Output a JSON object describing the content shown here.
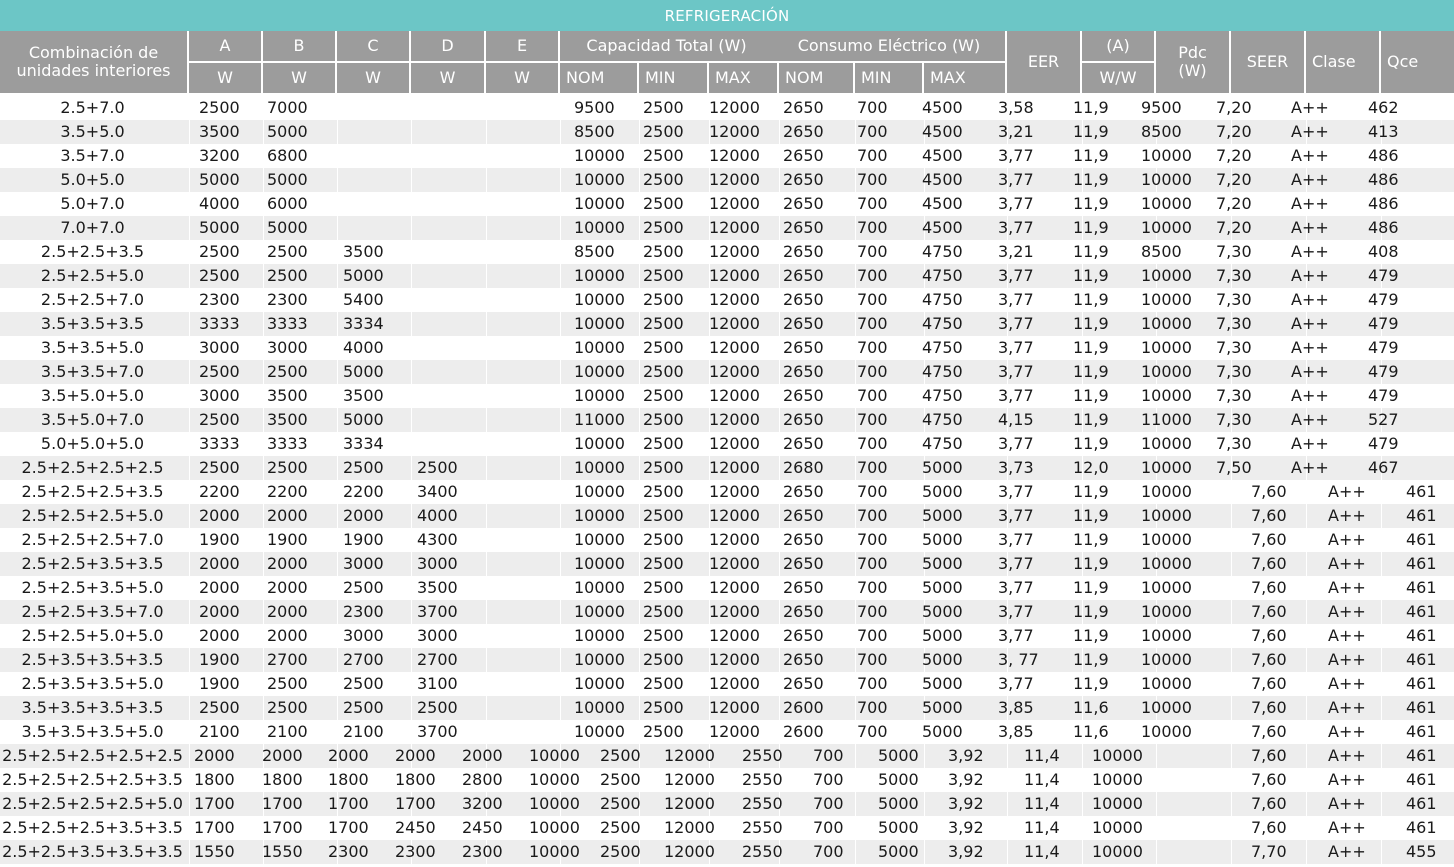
{
  "title": "REFRIGERACIÓN",
  "headers": {
    "combinacion": "Combinación de unidades interiores",
    "A": "A",
    "B": "B",
    "C": "C",
    "D": "D",
    "E": "E",
    "unit_w": "W",
    "capacidad": "Capacidad Total (W)",
    "consumo": "Consumo Eléctrico (W)",
    "nom": "NOM",
    "min": "MIN",
    "max": "MAX",
    "eer": "EER",
    "amp": "(A)",
    "ww": "W/W",
    "pdc": "Pdc (W)",
    "seer": "SEER",
    "clase": "Clase",
    "qce": "Qce"
  },
  "rows": [
    {
      "combo": "2.5+7.0",
      "vals": [
        "2500",
        "7000",
        "",
        "",
        "",
        "9500",
        "2500",
        "12000",
        "2650",
        "700",
        "4500",
        "3,58",
        "11,9",
        "9500",
        "7,20",
        "A++",
        "462"
      ]
    },
    {
      "combo": "3.5+5.0",
      "vals": [
        "3500",
        "5000",
        "",
        "",
        "",
        "8500",
        "2500",
        "12000",
        "2650",
        "700",
        "4500",
        "3,21",
        "11,9",
        "8500",
        "7,20",
        "A++",
        "413"
      ]
    },
    {
      "combo": "3.5+7.0",
      "vals": [
        "3200",
        "6800",
        "",
        "",
        "",
        "10000",
        "2500",
        "12000",
        "2650",
        "700",
        "4500",
        "3,77",
        "11,9",
        "10000",
        "7,20",
        "A++",
        "486"
      ]
    },
    {
      "combo": "5.0+5.0",
      "vals": [
        "5000",
        "5000",
        "",
        "",
        "",
        "10000",
        "2500",
        "12000",
        "2650",
        "700",
        "4500",
        "3,77",
        "11,9",
        "10000",
        "7,20",
        "A++",
        "486"
      ]
    },
    {
      "combo": "5.0+7.0",
      "vals": [
        "4000",
        "6000",
        "",
        "",
        "",
        "10000",
        "2500",
        "12000",
        "2650",
        "700",
        "4500",
        "3,77",
        "11,9",
        "10000",
        "7,20",
        "A++",
        "486"
      ]
    },
    {
      "combo": "7.0+7.0",
      "vals": [
        "5000",
        "5000",
        "",
        "",
        "",
        "10000",
        "2500",
        "12000",
        "2650",
        "700",
        "4500",
        "3,77",
        "11,9",
        "10000",
        "7,20",
        "A++",
        "486"
      ]
    },
    {
      "combo": "2.5+2.5+3.5",
      "vals": [
        "2500",
        "2500",
        "3500",
        "",
        "",
        "8500",
        "2500",
        "12000",
        "2650",
        "700",
        "4750",
        "3,21",
        "11,9",
        "8500",
        "7,30",
        "A++",
        "408"
      ]
    },
    {
      "combo": "2.5+2.5+5.0",
      "vals": [
        "2500",
        "2500",
        "5000",
        "",
        "",
        "10000",
        "2500",
        "12000",
        "2650",
        "700",
        "4750",
        "3,77",
        "11,9",
        "10000",
        "7,30",
        "A++",
        "479"
      ]
    },
    {
      "combo": "2.5+2.5+7.0",
      "vals": [
        "2300",
        "2300",
        "5400",
        "",
        "",
        "10000",
        "2500",
        "12000",
        "2650",
        "700",
        "4750",
        "3,77",
        "11,9",
        "10000",
        "7,30",
        "A++",
        "479"
      ]
    },
    {
      "combo": "3.5+3.5+3.5",
      "vals": [
        "3333",
        "3333",
        "3334",
        "",
        "",
        "10000",
        "2500",
        "12000",
        "2650",
        "700",
        "4750",
        "3,77",
        "11,9",
        "10000",
        "7,30",
        "A++",
        "479"
      ]
    },
    {
      "combo": "3.5+3.5+5.0",
      "vals": [
        "3000",
        "3000",
        "4000",
        "",
        "",
        "10000",
        "2500",
        "12000",
        "2650",
        "700",
        "4750",
        "3,77",
        "11,9",
        "10000",
        "7,30",
        "A++",
        "479"
      ]
    },
    {
      "combo": "3.5+3.5+7.0",
      "vals": [
        "2500",
        "2500",
        "5000",
        "",
        "",
        "10000",
        "2500",
        "12000",
        "2650",
        "700",
        "4750",
        "3,77",
        "11,9",
        "10000",
        "7,30",
        "A++",
        "479"
      ]
    },
    {
      "combo": "3.5+5.0+5.0",
      "vals": [
        "3000",
        "3500",
        "3500",
        "",
        "",
        "10000",
        "2500",
        "12000",
        "2650",
        "700",
        "4750",
        "3,77",
        "11,9",
        "10000",
        "7,30",
        "A++",
        "479"
      ]
    },
    {
      "combo": "3.5+5.0+7.0",
      "vals": [
        "2500",
        "3500",
        "5000",
        "",
        "",
        "11000",
        "2500",
        "12000",
        "2650",
        "700",
        "4750",
        "4,15",
        "11,9",
        "11000",
        "7,30",
        "A++",
        "527"
      ]
    },
    {
      "combo": "5.0+5.0+5.0",
      "vals": [
        "3333",
        "3333",
        "3334",
        "",
        "",
        "10000",
        "2500",
        "12000",
        "2650",
        "700",
        "4750",
        "3,77",
        "11,9",
        "10000",
        "7,30",
        "A++",
        "479"
      ]
    },
    {
      "combo": "2.5+2.5+2.5+2.5",
      "vals": [
        "2500",
        "2500",
        "2500",
        "2500",
        "",
        "10000",
        "2500",
        "12000",
        "2680",
        "700",
        "5000",
        "3,73",
        "12,0",
        "10000",
        "7,50",
        "A++",
        "467"
      ]
    },
    {
      "combo": "2.5+2.5+2.5+3.5",
      "vals": [
        "2200",
        "2200",
        "2200",
        "3400",
        "",
        "10000",
        "2500",
        "12000",
        "2650",
        "700",
        "5000",
        "3,77",
        "11,9",
        "10000",
        "7,60",
        "A++",
        "461"
      ]
    },
    {
      "combo": "2.5+2.5+2.5+5.0",
      "vals": [
        "2000",
        "2000",
        "2000",
        "4000",
        "",
        "10000",
        "2500",
        "12000",
        "2650",
        "700",
        "5000",
        "3,77",
        "11,9",
        "10000",
        "7,60",
        "A++",
        "461"
      ]
    },
    {
      "combo": "2.5+2.5+2.5+7.0",
      "vals": [
        "1900",
        "1900",
        "1900",
        "4300",
        "",
        "10000",
        "2500",
        "12000",
        "2650",
        "700",
        "5000",
        "3,77",
        "11,9",
        "10000",
        "7,60",
        "A++",
        "461"
      ]
    },
    {
      "combo": "2.5+2.5+3.5+3.5",
      "vals": [
        "2000",
        "2000",
        "3000",
        "3000",
        "",
        "10000",
        "2500",
        "12000",
        "2650",
        "700",
        "5000",
        "3,77",
        "11,9",
        "10000",
        "7,60",
        "A++",
        "461"
      ]
    },
    {
      "combo": "2.5+2.5+3.5+5.0",
      "vals": [
        "2000",
        "2000",
        "2500",
        "3500",
        "",
        "10000",
        "2500",
        "12000",
        "2650",
        "700",
        "5000",
        "3,77",
        "11,9",
        "10000",
        "7,60",
        "A++",
        "461"
      ]
    },
    {
      "combo": "2.5+2.5+3.5+7.0",
      "vals": [
        "2000",
        "2000",
        "2300",
        "3700",
        "",
        "10000",
        "2500",
        "12000",
        "2650",
        "700",
        "5000",
        "3,77",
        "11,9",
        "10000",
        "7,60",
        "A++",
        "461"
      ]
    },
    {
      "combo": "2.5+2.5+5.0+5.0",
      "vals": [
        "2000",
        "2000",
        "3000",
        "3000",
        "",
        "10000",
        "2500",
        "12000",
        "2650",
        "700",
        "5000",
        "3,77",
        "11,9",
        "10000",
        "7,60",
        "A++",
        "461"
      ]
    },
    {
      "combo": "2.5+3.5+3.5+3.5",
      "vals": [
        "1900",
        "2700",
        "2700",
        "2700",
        "",
        "10000",
        "2500",
        "12000",
        "2650",
        "700",
        "5000",
        "3, 77",
        "11,9",
        "10000",
        "7,60",
        "A++",
        "461"
      ]
    },
    {
      "combo": "2.5+3.5+3.5+5.0",
      "vals": [
        "1900",
        "2500",
        "2500",
        "3100",
        "",
        "10000",
        "2500",
        "12000",
        "2650",
        "700",
        "5000",
        "3,77",
        "11,9",
        "10000",
        "7,60",
        "A++",
        "461"
      ]
    },
    {
      "combo": "3.5+3.5+3.5+3.5",
      "vals": [
        "2500",
        "2500",
        "2500",
        "2500",
        "",
        "10000",
        "2500",
        "12000",
        "2600",
        "700",
        "5000",
        "3,85",
        "11,6",
        "10000",
        "7,60",
        "A++",
        "461"
      ]
    },
    {
      "combo": "3.5+3.5+3.5+5.0",
      "vals": [
        "2100",
        "2100",
        "2100",
        "3700",
        "",
        "10000",
        "2500",
        "12000",
        "2600",
        "700",
        "5000",
        "3,85",
        "11,6",
        "10000",
        "7,60",
        "A++",
        "461"
      ]
    },
    {
      "combo": "2.5+2.5+2.5+2.5+2.5",
      "vals": [
        "2000",
        "2000",
        "2000",
        "2000",
        "2000",
        "10000",
        "2500",
        "12000",
        "2550",
        "700",
        "5000",
        "3,92",
        "11,4",
        "10000",
        "7,60",
        "A++",
        "461"
      ]
    },
    {
      "combo": "2.5+2.5+2.5+2.5+3.5",
      "vals": [
        "1800",
        "1800",
        "1800",
        "1800",
        "2800",
        "10000",
        "2500",
        "12000",
        "2550",
        "700",
        "5000",
        "3,92",
        "11,4",
        "10000",
        "7,60",
        "A++",
        "461"
      ]
    },
    {
      "combo": "2.5+2.5+2.5+2.5+5.0",
      "vals": [
        "1700",
        "1700",
        "1700",
        "1700",
        "3200",
        "10000",
        "2500",
        "12000",
        "2550",
        "700",
        "5000",
        "3,92",
        "11,4",
        "10000",
        "7,60",
        "A++",
        "461"
      ]
    },
    {
      "combo": "2.5+2.5+2.5+3.5+3.5",
      "vals": [
        "1700",
        "1700",
        "1700",
        "2450",
        "2450",
        "10000",
        "2500",
        "12000",
        "2550",
        "700",
        "5000",
        "3,92",
        "11,4",
        "10000",
        "7,60",
        "A++",
        "461"
      ]
    },
    {
      "combo": "2.5+2.5+3.5+3.5+3.5",
      "vals": [
        "1550",
        "1550",
        "2300",
        "2300",
        "2300",
        "10000",
        "2500",
        "12000",
        "2550",
        "700",
        "5000",
        "3,92",
        "11,4",
        "10000",
        "7,70",
        "A++",
        "455"
      ]
    }
  ]
}
